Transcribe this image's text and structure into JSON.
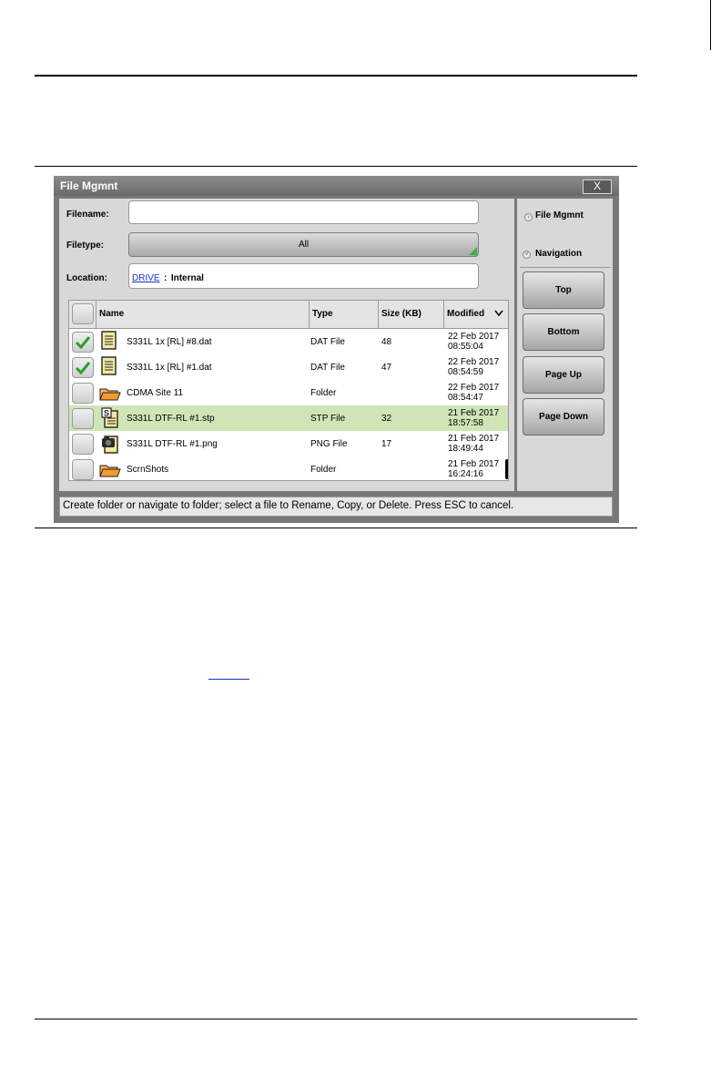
{
  "window": {
    "title": "File Mgmnt",
    "close_label": "X"
  },
  "form": {
    "filename_label": "Filename:",
    "filename_value": "",
    "filetype_label": "Filetype:",
    "filetype_value": "All",
    "location_label": "Location:",
    "location_link": "DRIVE",
    "location_sep": ":",
    "location_value": "Internal"
  },
  "table": {
    "columns": [
      "Name",
      "Type",
      "Size (KB)",
      "Modified"
    ],
    "rows": [
      {
        "name": "S331L 1x [RL] #8.dat",
        "type": "DAT File",
        "size": "48",
        "date": "22 Feb 2017",
        "time": "08:55:04",
        "checked": true,
        "icon": "document-icon"
      },
      {
        "name": "S331L 1x [RL] #1.dat",
        "type": "DAT File",
        "size": "47",
        "date": "22 Feb 2017",
        "time": "08:54:59",
        "checked": true,
        "icon": "document-icon"
      },
      {
        "name": "CDMA Site 11",
        "type": "Folder",
        "size": "",
        "date": "22 Feb 2017",
        "time": "08:54:47",
        "checked": false,
        "icon": "folder-icon"
      },
      {
        "name": "S331L DTF-RL #1.stp",
        "type": "STP File",
        "size": "32",
        "date": "21 Feb 2017",
        "time": "18:57:58",
        "checked": false,
        "icon": "setup-file-icon"
      },
      {
        "name": "S331L DTF-RL #1.png",
        "type": "PNG File",
        "size": "17",
        "date": "21 Feb 2017",
        "time": "18:49:44",
        "checked": false,
        "icon": "camera-icon"
      },
      {
        "name": "ScrnShots",
        "type": "Folder",
        "size": "",
        "date": "21 Feb 2017",
        "time": "16:24:16",
        "checked": false,
        "icon": "folder-icon"
      }
    ]
  },
  "side": {
    "menu_title": "File Mgmnt",
    "section_title": "Navigation",
    "buttons": [
      "Top",
      "Bottom",
      "Page Up",
      "Page Down"
    ]
  },
  "status": "Create folder or navigate to folder; select a file to Rename, Copy, or Delete. Press ESC to cancel.",
  "colors": {
    "selected_row": "#cfe5b6",
    "check": "#2e9e2e",
    "folder": "#f39a2c",
    "link": "#1a32c8"
  }
}
